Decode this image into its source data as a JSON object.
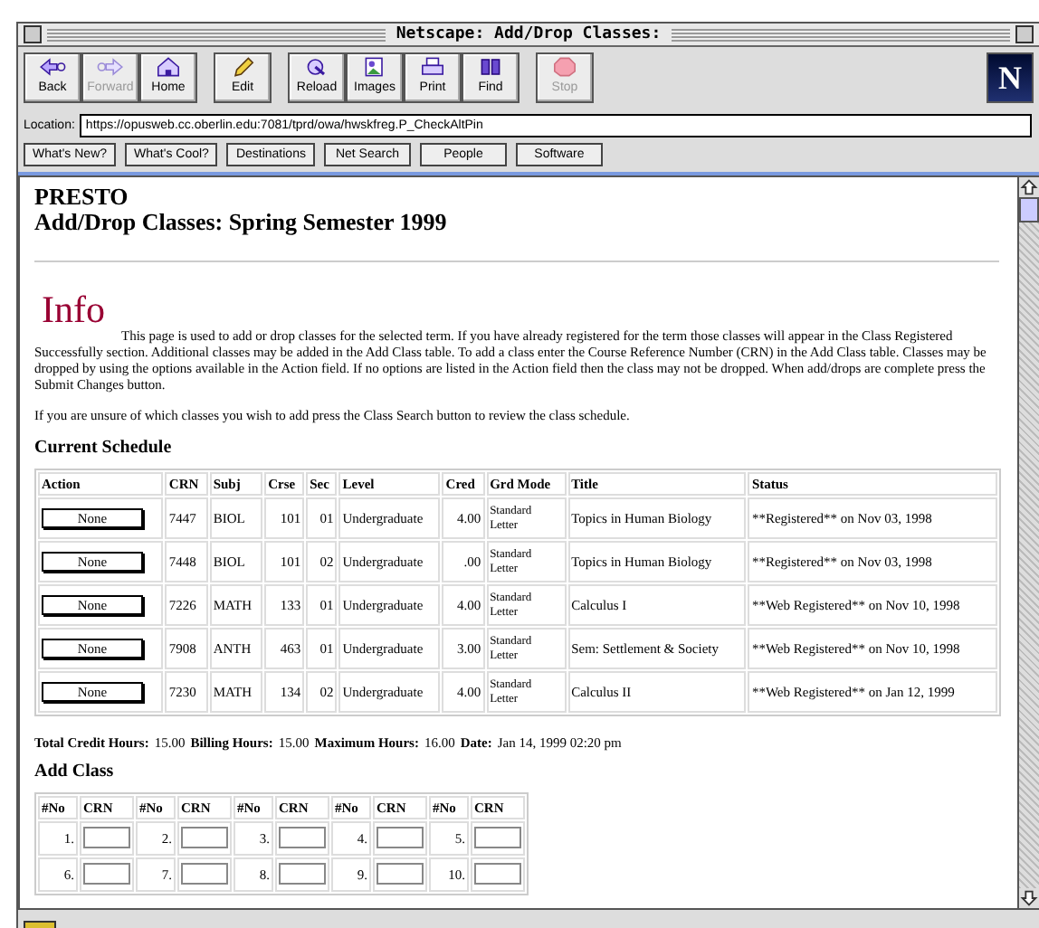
{
  "window": {
    "title": "Netscape: Add/Drop Classes:"
  },
  "toolbar": {
    "groups": [
      [
        {
          "kind": "back",
          "label": "Back",
          "disabled": false
        },
        {
          "kind": "forward",
          "label": "Forward",
          "disabled": true
        },
        {
          "kind": "home",
          "label": "Home",
          "disabled": false
        }
      ],
      [
        {
          "kind": "edit",
          "label": "Edit",
          "disabled": false
        }
      ],
      [
        {
          "kind": "reload",
          "label": "Reload",
          "disabled": false
        },
        {
          "kind": "images",
          "label": "Images",
          "disabled": false
        },
        {
          "kind": "print",
          "label": "Print",
          "disabled": false
        },
        {
          "kind": "find",
          "label": "Find",
          "disabled": false
        }
      ],
      [
        {
          "kind": "stop",
          "label": "Stop",
          "disabled": true
        }
      ]
    ],
    "logo": "N"
  },
  "location": {
    "label": "Location:",
    "value": "https://opusweb.cc.oberlin.edu:7081/tprd/owa/hwskfreg.P_CheckAltPin"
  },
  "directory_buttons": [
    "What's New?",
    "What's Cool?",
    "Destinations",
    "Net Search",
    "People",
    "Software"
  ],
  "page": {
    "heading": "PRESTO",
    "subheading": "Add/Drop Classes: Spring Semester 1999",
    "info_title": "Info",
    "paragraphs": [
      "This page is used to add or drop classes for the selected term. If you have already registered for the term those classes will appear in the Class Registered Successfully section. Additional classes may be added in the Add Class table. To add a class enter the Course Reference Number (CRN) in the Add Class table. Classes may be dropped by using the options available in the Action field. If no options are listed in the Action field then the class may not be dropped. When add/drops are complete press the Submit Changes button.",
      "If you are unsure of which classes you wish to add press the Class Search button to review the class schedule."
    ],
    "schedule": {
      "title": "Current Schedule",
      "columns": [
        "Action",
        "CRN",
        "Subj",
        "Crse",
        "Sec",
        "Level",
        "Cred",
        "Grd Mode",
        "Title",
        "Status"
      ],
      "rows": [
        {
          "action": "None",
          "crn": "7447",
          "subj": "BIOL",
          "crse": "101",
          "sec": "01",
          "level": "Undergraduate",
          "cred": "4.00",
          "grd_mode": "Standard Letter",
          "title": "Topics in Human Biology",
          "status": "**Registered** on Nov 03, 1998"
        },
        {
          "action": "None",
          "crn": "7448",
          "subj": "BIOL",
          "crse": "101",
          "sec": "02",
          "level": "Undergraduate",
          "cred": ".00",
          "grd_mode": "Standard Letter",
          "title": "Topics in Human Biology",
          "status": "**Registered** on Nov 03, 1998"
        },
        {
          "action": "None",
          "crn": "7226",
          "subj": "MATH",
          "crse": "133",
          "sec": "01",
          "level": "Undergraduate",
          "cred": "4.00",
          "grd_mode": "Standard Letter",
          "title": "Calculus I",
          "status": "**Web Registered** on Nov 10, 1998"
        },
        {
          "action": "None",
          "crn": "7908",
          "subj": "ANTH",
          "crse": "463",
          "sec": "01",
          "level": "Undergraduate",
          "cred": "3.00",
          "grd_mode": "Standard Letter",
          "title": "Sem: Settlement & Society",
          "status": "**Web Registered** on Nov 10, 1998"
        },
        {
          "action": "None",
          "crn": "7230",
          "subj": "MATH",
          "crse": "134",
          "sec": "02",
          "level": "Undergraduate",
          "cred": "4.00",
          "grd_mode": "Standard Letter",
          "title": "Calculus II",
          "status": "**Web Registered** on Jan 12, 1999"
        }
      ]
    },
    "totals": [
      {
        "label": "Total Credit Hours:",
        "value": "15.00"
      },
      {
        "label": "Billing Hours:",
        "value": "15.00"
      },
      {
        "label": "Maximum Hours:",
        "value": "16.00"
      },
      {
        "label": "Date:",
        "value": "Jan 14, 1999 02:20 pm"
      }
    ],
    "add_class": {
      "title": "Add Class",
      "columns": [
        "#No",
        "CRN",
        "#No",
        "CRN",
        "#No",
        "CRN",
        "#No",
        "CRN",
        "#No",
        "CRN"
      ],
      "slots": [
        "1.",
        "2.",
        "3.",
        "4.",
        "5.",
        "6.",
        "7.",
        "8.",
        "9.",
        "10."
      ]
    }
  }
}
